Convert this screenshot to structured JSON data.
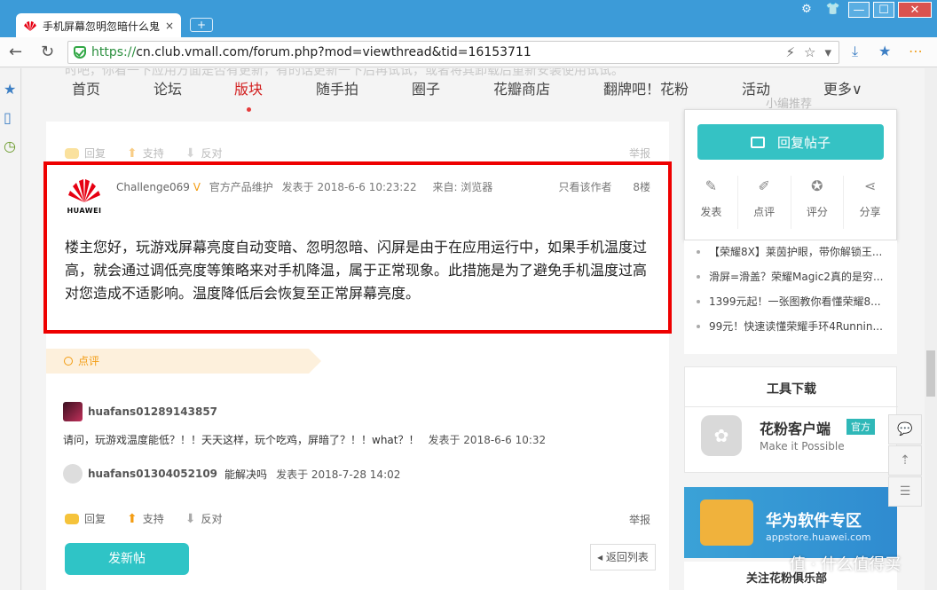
{
  "browser": {
    "tab_title": "手机屏幕忽明忽暗什么鬼",
    "tab_close": "×",
    "newtab": "+",
    "url_https": "https://",
    "url_rest": "cn.club.vmall.com/forum.php?mod=viewthread&tid=16153711",
    "win_controls": [
      "⚙",
      "👕",
      "—",
      "☐",
      "✕"
    ]
  },
  "site": {
    "ghost_text": "时吧，你看一下应用方面是否有更新，有的话更新一下后再试试，或者将其卸载后重新安装使用试试。",
    "nav": [
      "首页",
      "论坛",
      "版块",
      "随手拍",
      "圈子",
      "花瓣商店",
      "翻牌吧！花粉",
      "活动",
      "更多∨"
    ]
  },
  "prev_actions": {
    "reply": "回复",
    "support": "支持",
    "oppose": "反对",
    "report": "举报"
  },
  "post": {
    "logo_text": "HUAWEI",
    "author": "Challenge069",
    "vmark": "V",
    "role": "官方产品维护",
    "posted": "发表于 2018-6-6 10:23:22",
    "source": "来自: 浏览器",
    "only_author": "只看该作者",
    "floor": "8楼",
    "body": "楼主您好，玩游戏屏幕亮度自动变暗、忽明忽暗、闪屏是由于在应用运行中，如果手机温度过高，就会通过调低亮度等策略来对手机降温，属于正常现象。此措施是为了避免手机温度过高对您造成不适影响。温度降低后会恢复至正常屏幕亮度。"
  },
  "comments": {
    "tag": "点评",
    "items": [
      {
        "user": "huafans01289143857",
        "text": "请问，玩游戏温度能低？！！天天这样，玩个吃鸡，屏暗了？！！what？！",
        "time": "发表于 2018-6-6 10:32"
      },
      {
        "user": "huafans01304052109",
        "text": "能解决吗",
        "time": "发表于 2018-7-28 14:02"
      }
    ]
  },
  "post_actions": {
    "reply": "回复",
    "support": "支持",
    "oppose": "反对",
    "report": "举报"
  },
  "buttons": {
    "new_post": "发新帖",
    "back_list": "返回列表"
  },
  "right": {
    "ghost_rec": "小编推荐",
    "reply_post": "回复帖子",
    "actions": [
      {
        "label": "发表",
        "icon": "✎"
      },
      {
        "label": "点评",
        "icon": "✐"
      },
      {
        "label": "评分",
        "icon": "✪"
      },
      {
        "label": "分享",
        "icon": "⋖"
      }
    ],
    "recommend": [
      "【荣耀8X】莱茵护眼，带你解锁王...",
      "滑屏=滑盖？荣耀Magic2真的是穷...",
      "1399元起！一张图教你看懂荣耀8...",
      "99元！快速读懂荣耀手环4Runnin..."
    ],
    "tools_title": "工具下载",
    "app_name": "花粉客户端",
    "app_badge": "官方",
    "app_sub": "Make it Possible",
    "banner_title": "华为软件专区",
    "banner_sub": "appstore.huawei.com",
    "follow_title": "关注花粉俱乐部"
  },
  "watermark": "值 · 什么值得买"
}
